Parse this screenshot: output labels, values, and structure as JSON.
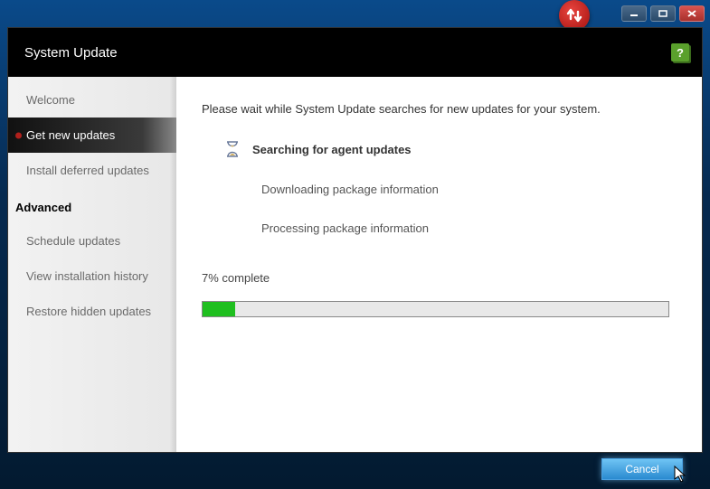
{
  "window": {
    "title": "System Update"
  },
  "sidebar": {
    "items": [
      {
        "label": "Welcome"
      },
      {
        "label": "Get new updates"
      },
      {
        "label": "Install deferred updates"
      }
    ],
    "section_label": "Advanced",
    "advanced_items": [
      {
        "label": "Schedule updates"
      },
      {
        "label": "View installation history"
      },
      {
        "label": "Restore hidden updates"
      }
    ],
    "active_index": 1
  },
  "main": {
    "intro": "Please wait while System Update searches for new updates for your system.",
    "status_heading": "Searching for agent updates",
    "step_download": "Downloading package information",
    "step_process": "Processing package information",
    "progress_text": "7% complete",
    "progress_percent": 7
  },
  "footer": {
    "cancel_label": "Cancel"
  },
  "icons": {
    "app_badge": "update-arrows-icon",
    "help": "?",
    "hourglass": "hourglass-icon"
  },
  "colors": {
    "progress_fill": "#1fbf1f",
    "accent_button": "#2a8ad0",
    "badge_red": "#b8201c"
  }
}
